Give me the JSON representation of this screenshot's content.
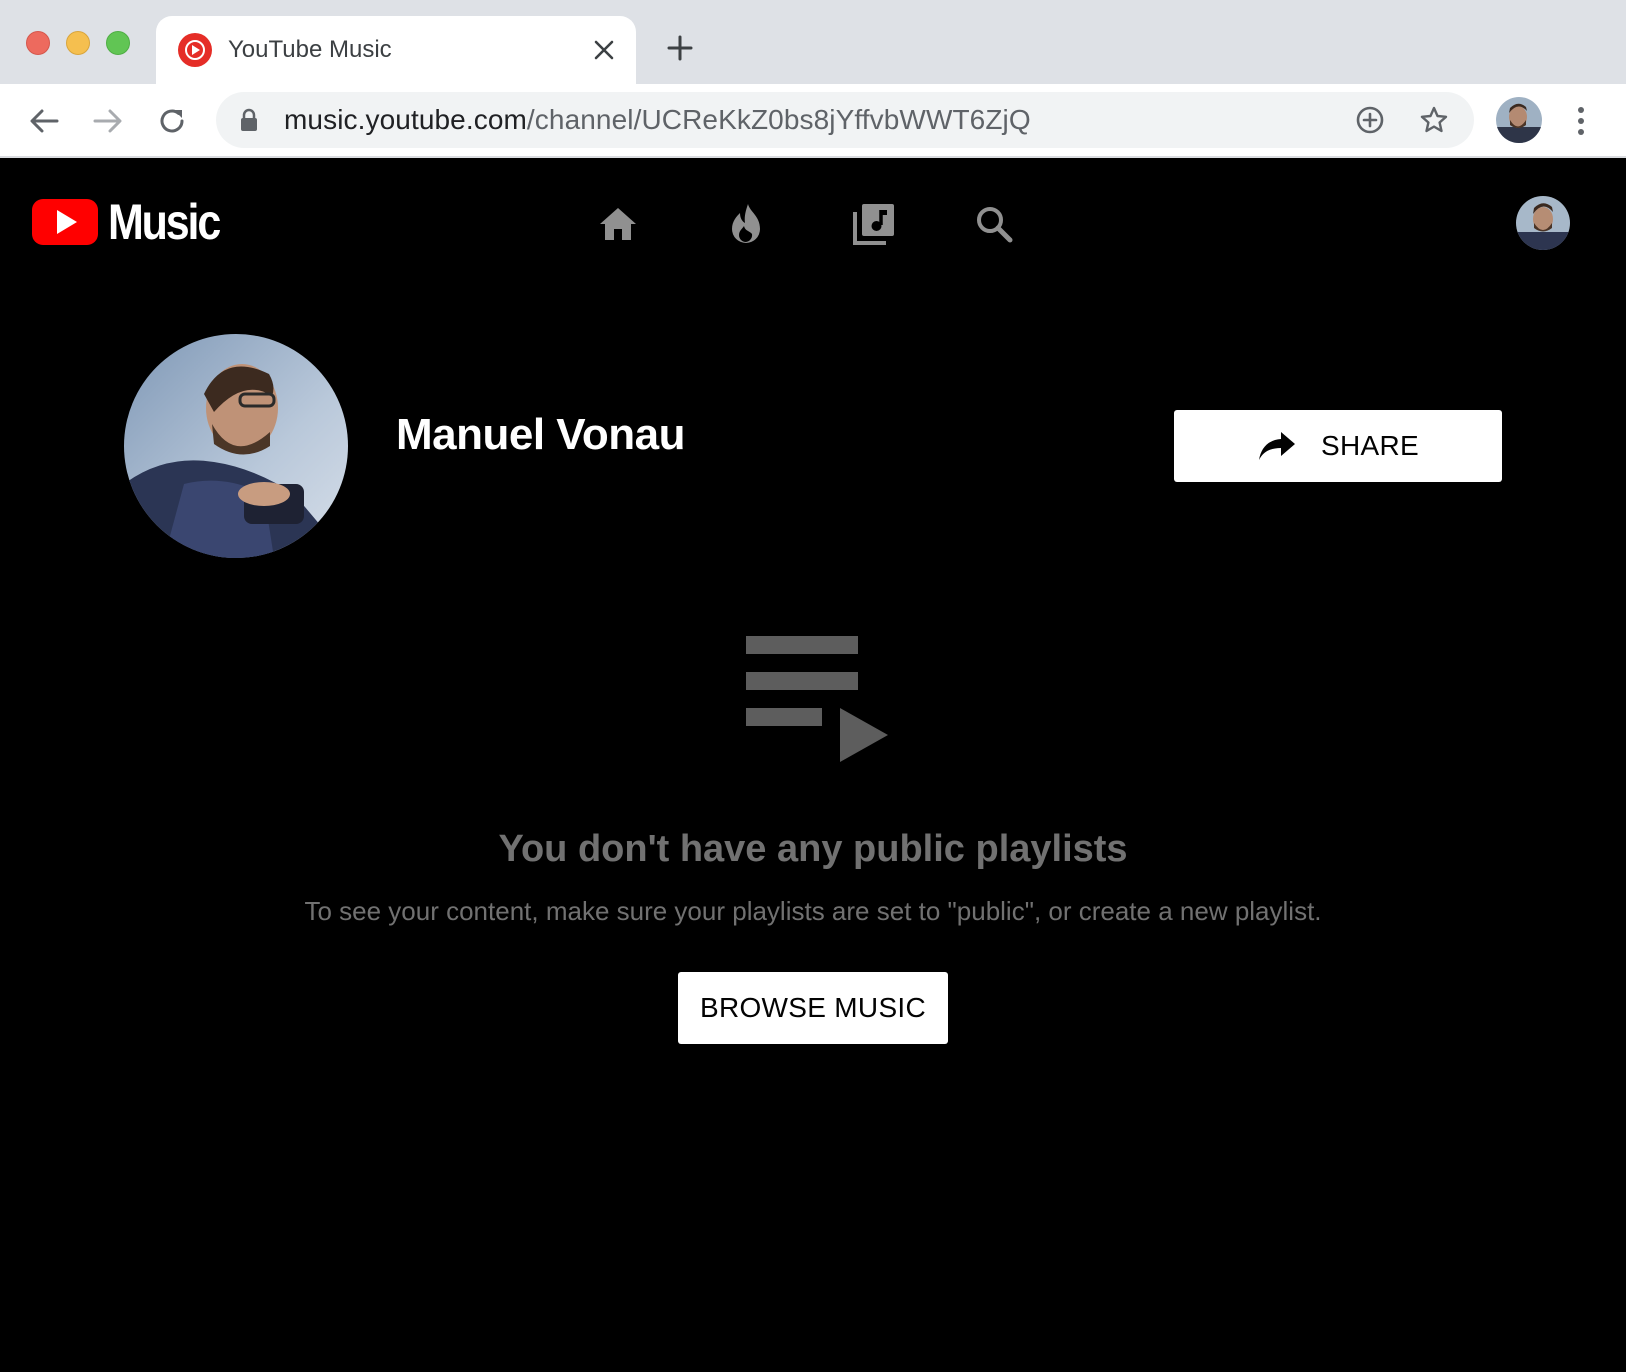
{
  "browser": {
    "tab": {
      "title": "YouTube Music",
      "favicon": "youtube-music-icon"
    },
    "url": {
      "host": "music.youtube.com",
      "path": "/channel/UCReKkZ0bs8jYffvbWWT6ZjQ"
    }
  },
  "app": {
    "brand": "Music",
    "nav": [
      {
        "id": "home",
        "icon": "home-icon"
      },
      {
        "id": "hotlist",
        "icon": "flame-icon"
      },
      {
        "id": "library",
        "icon": "library-music-icon"
      },
      {
        "id": "search",
        "icon": "search-icon"
      }
    ]
  },
  "channel": {
    "name": "Manuel Vonau",
    "share_label": "SHARE"
  },
  "empty_state": {
    "icon": "playlist-play-icon",
    "title": "You don't have any public playlists",
    "subtitle": "To see your content, make sure your playlists are set to \"public\", or create a new playlist.",
    "button_label": "BROWSE MUSIC"
  },
  "colors": {
    "brand_red": "#ff0000",
    "favicon_red": "#e52d27",
    "nav_icon": "#909090",
    "empty_text": "#717171"
  }
}
